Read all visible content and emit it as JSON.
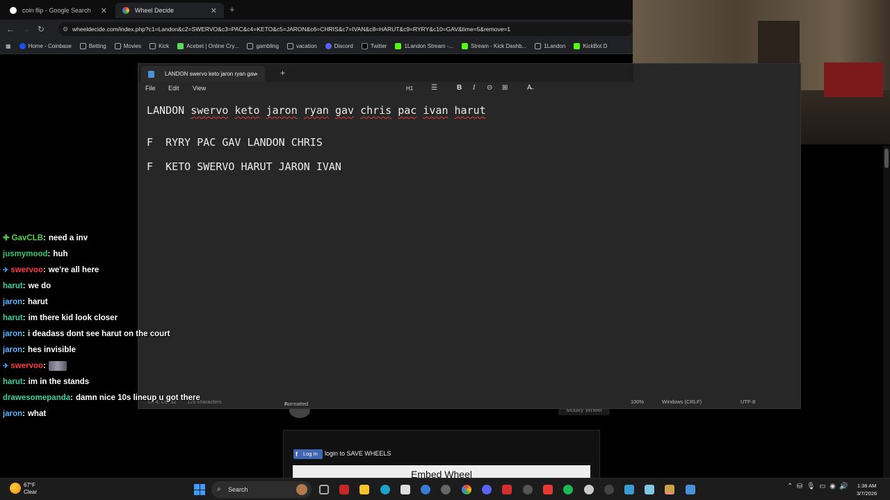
{
  "browser": {
    "tabs": [
      {
        "title": "coin flip - Google Search"
      },
      {
        "title": "Wheel Decide"
      }
    ],
    "url": "wheeldecide.com/index.php?c1=Landon&c2=SWERVO&c3=PAC&c4=KETO&c5=JARON&c6=CHRIS&c7=IVAN&c8=HARUT&c9=RYRY&c10=GAV&time=5&remove=1",
    "bookmarks": [
      "Home - Coinbase",
      "Betting",
      "Movies",
      "Kick",
      "Acebet | Online Cry...",
      "gambling",
      "vacation",
      "Discord",
      "Twitter",
      "1Landon Stream -...",
      "Stream - Kick Dashb...",
      "1Landon",
      "KickBot D"
    ]
  },
  "notepad": {
    "tab_title": "LANDON swervo keto jaron ryan gav",
    "menu": {
      "file": "File",
      "edit": "Edit",
      "view": "View"
    },
    "toolbar": {
      "heading": "H1"
    },
    "lines": [
      "LANDON swervo keto jaron ryan gav chris pac ivan harut",
      "F  RYRY PAC GAV LANDON CHRIS",
      "F  KETO SWERVO HARUT JARON IVAN"
    ],
    "status": {
      "position": "Ln 4, Col 32",
      "chars": "125 characters",
      "mode": "Formatted",
      "zoom": "100%",
      "line_ending": "Windows (CRLF)",
      "encoding": "UTF-8"
    }
  },
  "chat": [
    {
      "user": "GavCLB",
      "color": "#4fd14f",
      "text": "need a inv",
      "badge": "✚"
    },
    {
      "user": "jusmymood",
      "color": "#2ecc71",
      "text": "huh"
    },
    {
      "user": "swervoo",
      "color": "#ff3b3b",
      "text": "we're all here",
      "pin": "✈"
    },
    {
      "user": "harut",
      "color": "#3fd1a0",
      "text": "we do"
    },
    {
      "user": "jaron",
      "color": "#5ab3ff",
      "text": "harut"
    },
    {
      "user": "harut",
      "color": "#3fd1a0",
      "text": "im there kid look closer"
    },
    {
      "user": "jaron",
      "color": "#5ab3ff",
      "text": "i deadass dont see harut on the court"
    },
    {
      "user": "jaron",
      "color": "#5ab3ff",
      "text": "hes invisible"
    },
    {
      "user": "swervoo",
      "color": "#ff3b3b",
      "text": "",
      "pin": "✈",
      "emote": true
    },
    {
      "user": "harut",
      "color": "#3fd1a0",
      "text": "im in the stands"
    },
    {
      "user": "drawesomepanda",
      "color": "#3fd1a0",
      "text": "damn nice 10s lineup u got there"
    },
    {
      "user": "jaron",
      "color": "#5ab3ff",
      "text": "what"
    }
  ],
  "wheel_page": {
    "modify_button": "Modify Wheel",
    "fb_login": "Log In",
    "save_text": "login to SAVE WHEELS",
    "embed_title": "Embed Wheel"
  },
  "taskbar": {
    "temp": "67°F",
    "condition": "Clear",
    "search": "Search",
    "time": "1:38 AM",
    "date": "3/7/2026"
  }
}
